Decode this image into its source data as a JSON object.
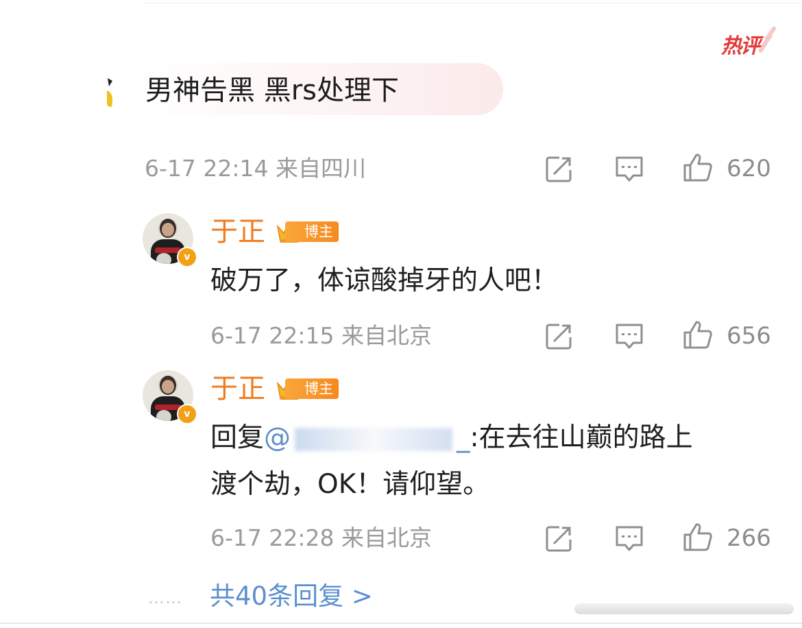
{
  "hot_badge": "热评",
  "main_comment": {
    "text": "男神告黑 黑rs处理下",
    "meta": "6-17 22:14 来自四川",
    "likes": "620"
  },
  "replies": [
    {
      "username": "于正",
      "tag": "博主",
      "text_line1": "破万了，体谅酸掉牙的人吧！",
      "meta": "6-17 22:15 来自北京",
      "likes": "656"
    },
    {
      "username": "于正",
      "tag": "博主",
      "reply_prefix": "回复",
      "mention_start": "@",
      "mention_end": "_",
      "text_line1": ":在去往山巅的路上",
      "text_line2": "渡个劫，OK！请仰望。",
      "meta": "6-17 22:28 来自北京",
      "likes": "266"
    }
  ],
  "more_replies": "共40条回复 >",
  "more_dots": "……",
  "icons": {
    "share": "share-icon",
    "comment": "comment-icon",
    "like": "thumbs-up-icon",
    "crown": "crown-icon",
    "verified": "verified-v-icon"
  },
  "colors": {
    "username": "#f07b1f",
    "mention": "#5e8fcb",
    "meta": "#9a9a9a",
    "hot": "#e23a3a"
  }
}
